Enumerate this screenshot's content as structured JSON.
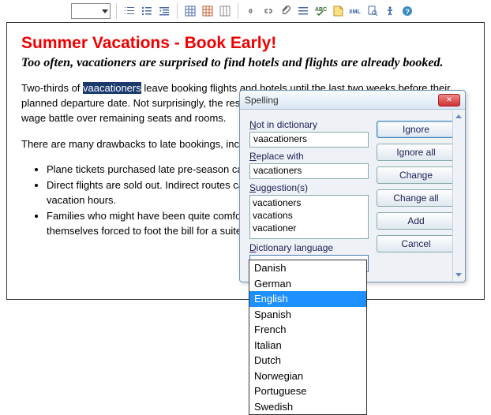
{
  "toolbar": {
    "icons": [
      "ordered-list",
      "unordered-list",
      "outdent",
      "separator",
      "insert-table",
      "edit-table",
      "table-extra",
      "separator",
      "link",
      "unlink",
      "attachment",
      "toggle-list",
      "spellcheck",
      "script",
      "xml",
      "search-doc",
      "accessibility",
      "help"
    ]
  },
  "document": {
    "heading": "Summer Vacations - Book Early!",
    "subhead": "Too often, vacationers are surprised to find hotels and flights are already booked.",
    "p1_a": "Two-thirds of ",
    "p1_hl": "vaacationers",
    "p1_b": " leave booking flights and hotels until the last two weeks before their planned departure date. Not surprisingly, the result is that during the high season, many tourists wage battle over remaining seats and rooms.",
    "p2": "There are many drawbacks to late bookings, including:",
    "bullets": [
      "Plane tickets purchased late pre-season can cost up to 50% more.",
      "Direct flights are sold out. Indirect routes can cost travelers an additional eight valuable vacation hours.",
      "Families who might have been quite comfortable in two standard hotel rooms, suddenly find themselves forced to foot the bill for a suite."
    ]
  },
  "dialog": {
    "title": "Spelling",
    "labels": {
      "not_in": "Not in dictionary",
      "replace": "Replace with",
      "suggest": "Suggestion(s)",
      "lang": "Dictionary language"
    },
    "not_in_value": "vaacationers",
    "replace_value": "vacationers",
    "suggestions": [
      "vacationers",
      "vacations",
      "vacationer"
    ],
    "lang_value": "English",
    "buttons": {
      "ignore": "Ignore",
      "ignore_all": "Ignore all",
      "change": "Change",
      "change_all": "Change all",
      "add": "Add",
      "cancel": "Cancel"
    }
  },
  "dropdown": {
    "items": [
      "Danish",
      "German",
      "English",
      "Spanish",
      "French",
      "Italian",
      "Dutch",
      "Norwegian",
      "Portuguese",
      "Swedish"
    ],
    "selected": "English"
  }
}
